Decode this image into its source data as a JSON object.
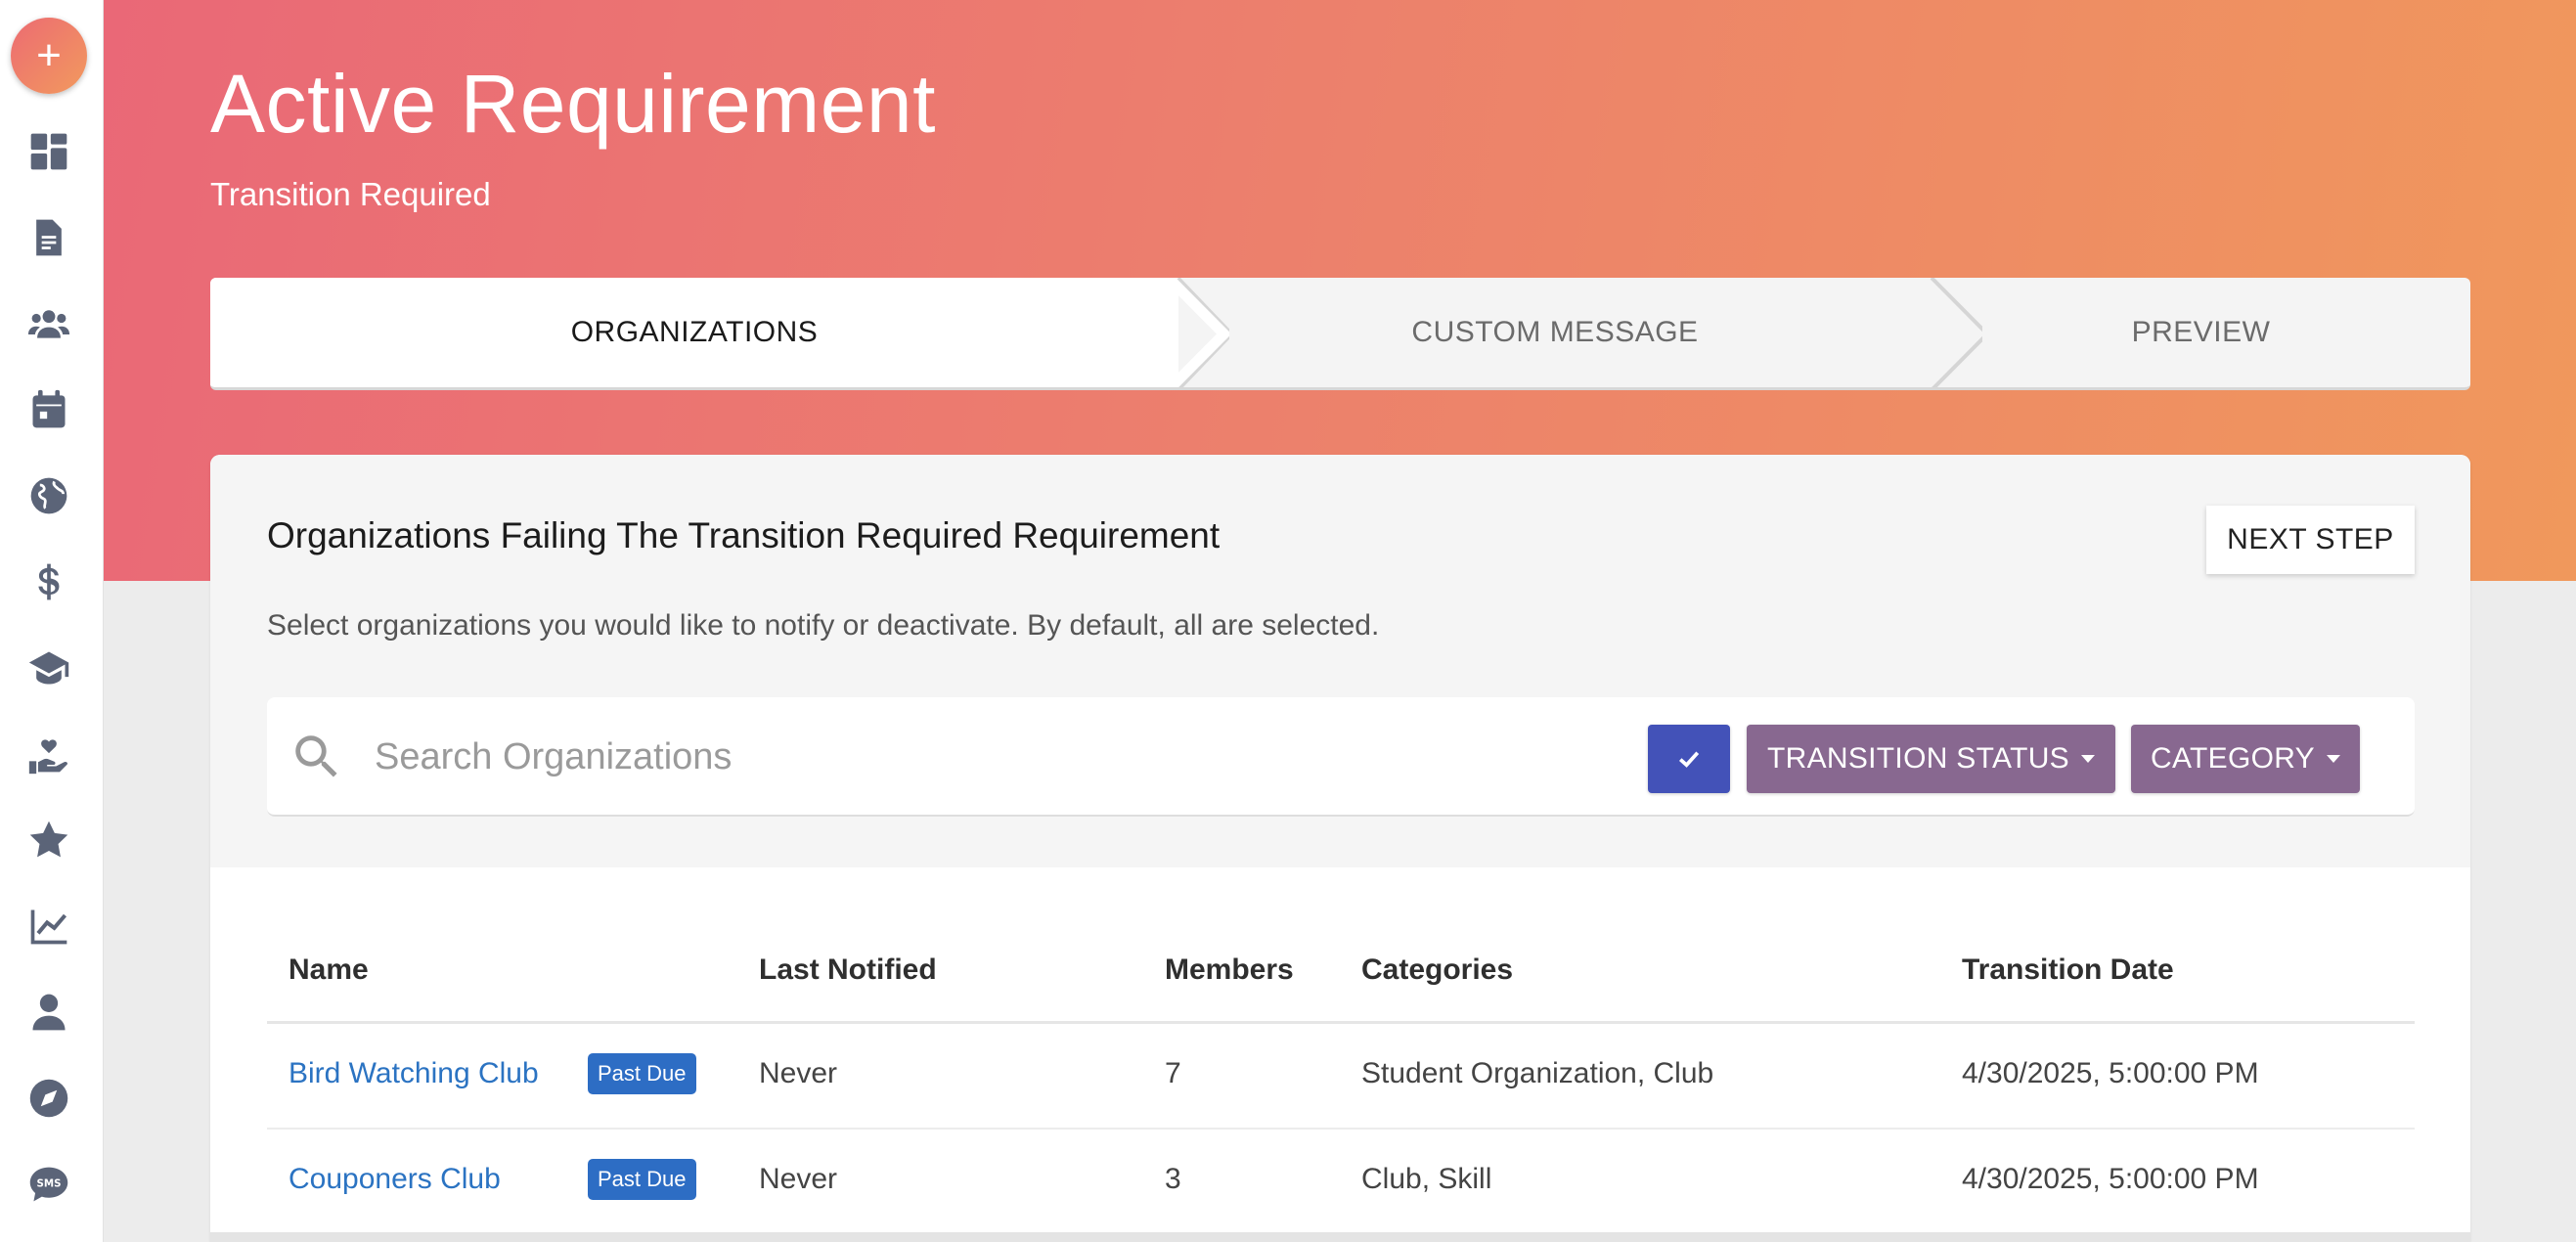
{
  "sidebar": {
    "add_label": "+",
    "items": [
      {
        "icon": "dashboard-icon"
      },
      {
        "icon": "document-icon"
      },
      {
        "icon": "users-icon"
      },
      {
        "icon": "calendar-icon"
      },
      {
        "icon": "globe-icon"
      },
      {
        "icon": "dollar-icon"
      },
      {
        "icon": "graduation-cap-icon"
      },
      {
        "icon": "hand-heart-icon"
      },
      {
        "icon": "star-icon"
      },
      {
        "icon": "chart-line-icon"
      },
      {
        "icon": "person-icon"
      },
      {
        "icon": "compass-icon"
      },
      {
        "icon": "sms-icon"
      }
    ]
  },
  "header": {
    "title": "Active Requirement",
    "subtitle": "Transition Required"
  },
  "stepper": {
    "steps": [
      {
        "label": "ORGANIZATIONS",
        "active": true
      },
      {
        "label": "CUSTOM MESSAGE",
        "active": false
      },
      {
        "label": "PREVIEW",
        "active": false
      }
    ]
  },
  "card": {
    "title": "Organizations Failing The Transition Required Requirement",
    "next_label": "NEXT STEP",
    "description": "Select organizations you would like to notify or deactivate. By default, all are selected.",
    "search": {
      "placeholder": "Search Organizations",
      "value": ""
    },
    "filters": {
      "transition_status_label": "TRANSITION STATUS",
      "category_label": "CATEGORY"
    }
  },
  "table": {
    "columns": [
      "Name",
      "Last Notified",
      "Members",
      "Categories",
      "Transition Date"
    ],
    "rows": [
      {
        "name": "Bird Watching Club",
        "badge": "Past Due",
        "last_notified": "Never",
        "members": "7",
        "categories": "Student Organization, Club",
        "transition_date": "4/30/2025, 5:00:00 PM"
      },
      {
        "name": "Couponers Club",
        "badge": "Past Due",
        "last_notified": "Never",
        "members": "3",
        "categories": "Club, Skill",
        "transition_date": "4/30/2025, 5:00:00 PM"
      }
    ]
  },
  "colors": {
    "header_gradient_start": "#ea6877",
    "header_gradient_end": "#f0985c",
    "check_button": "#4352b8",
    "filter_button": "#886890",
    "badge": "#2d6dc4",
    "link": "#2b73c2"
  }
}
